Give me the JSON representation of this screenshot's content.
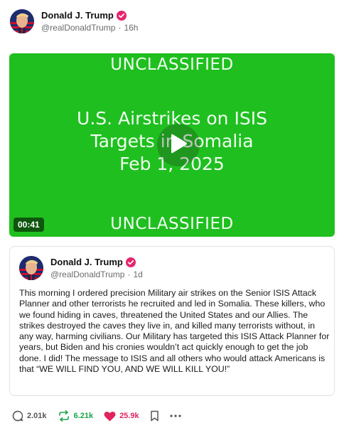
{
  "post": {
    "author": {
      "display_name": "Donald J. Trump",
      "handle": "@realDonaldTrump",
      "time": "16h",
      "separator": "·",
      "verified_icon": "verified-badge-icon",
      "avatar": "avatar-photo"
    },
    "video": {
      "top_label": "UNCLASSIFIED",
      "title_line1": "U.S. Airstrikes on ISIS",
      "title_line2": "Targets in Somalia",
      "title_line3": "Feb 1, 2025",
      "bottom_label": "UNCLASSIFIED",
      "duration": "00:41",
      "background_color": "#1fbf1f",
      "play_icon": "play-icon"
    },
    "quoted": {
      "author": {
        "display_name": "Donald J. Trump",
        "handle": "@realDonaldTrump",
        "time": "1d",
        "separator": "·"
      },
      "text": "This morning I ordered precision Military air strikes on the Senior ISIS Attack Planner and other terrorists he recruited and led in Somalia. These killers, who we found hiding in caves, threatened the United States and our Allies. The strikes destroyed the caves they live in, and killed many terrorists without, in any way, harming civilians. Our Military has targeted this ISIS Attack Planner for years, but Biden and his cronies wouldn’t act quickly enough to get the job done. I did! The message to ISIS and all others who would attack Americans is that “WE WILL FIND YOU, AND WE WILL KILL YOU!”"
    },
    "actions": {
      "replies": "2.01k",
      "retruths": "6.21k",
      "likes": "25.9k",
      "icons": [
        "reply-icon",
        "retruth-icon",
        "like-icon",
        "bookmark-icon",
        "more-icon"
      ]
    }
  },
  "colors": {
    "verified": "#e6266e",
    "retruth": "#1aa34a",
    "like": "#e0245e",
    "muted": "#6b6b6b"
  }
}
